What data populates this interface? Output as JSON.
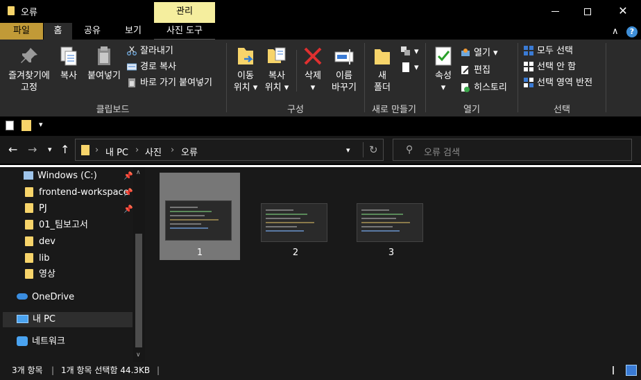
{
  "window": {
    "title": "오류",
    "context_tab": "관리",
    "minimize": "—",
    "maximize": "☐",
    "close": "✕"
  },
  "tabs": {
    "file": "파일",
    "home": "홈",
    "share": "공유",
    "view": "보기",
    "tools": "사진 도구",
    "collapse": "∧",
    "help": "?"
  },
  "ribbon": {
    "clipboard": {
      "label": "클립보드",
      "pin_line1": "즐겨찾기에",
      "pin_line2": "고정",
      "copy": "복사",
      "paste": "붙여넣기",
      "cut": "잘라내기",
      "copy_path": "경로 복사",
      "paste_shortcut": "바로 가기 붙여넣기"
    },
    "organize": {
      "label": "구성",
      "move_line1": "이동",
      "move_line2": "위치",
      "copy_line1": "복사",
      "copy_line2": "위치",
      "delete": "삭제",
      "rename_line1": "이름",
      "rename_line2": "바꾸기"
    },
    "new": {
      "label": "새로 만들기",
      "folder_line1": "새",
      "folder_line2": "폴더"
    },
    "open": {
      "label": "열기",
      "properties": "속성",
      "open": "열기",
      "edit": "편집",
      "history": "히스토리"
    },
    "select": {
      "label": "선택",
      "select_all": "모두 선택",
      "select_none": "선택 안 함",
      "invert": "선택 영역 반전"
    }
  },
  "address": {
    "crumbs": [
      "내 PC",
      "사진",
      "오류"
    ],
    "sep": "›",
    "search_placeholder": "오류 검색"
  },
  "nav": {
    "items": [
      {
        "label": "Windows (C:)"
      },
      {
        "label": "frontend-workspace"
      },
      {
        "label": "PJ"
      },
      {
        "label": "01_팀보고서"
      },
      {
        "label": "dev"
      },
      {
        "label": "lib"
      },
      {
        "label": "영상"
      },
      {
        "label": "OneDrive"
      },
      {
        "label": "내 PC"
      },
      {
        "label": "네트워크"
      }
    ]
  },
  "files": [
    {
      "name": "1",
      "selected": true
    },
    {
      "name": "2",
      "selected": false
    },
    {
      "name": "3",
      "selected": false
    }
  ],
  "status": {
    "count": "3개 항목",
    "selection": "1개 항목 선택함 44.3KB"
  },
  "colors": {
    "accent_folder": "#f7d46a",
    "file_tab": "#c19a37",
    "context_tab": "#f5ee9e",
    "ribbon_bg": "#2b2b2b"
  }
}
